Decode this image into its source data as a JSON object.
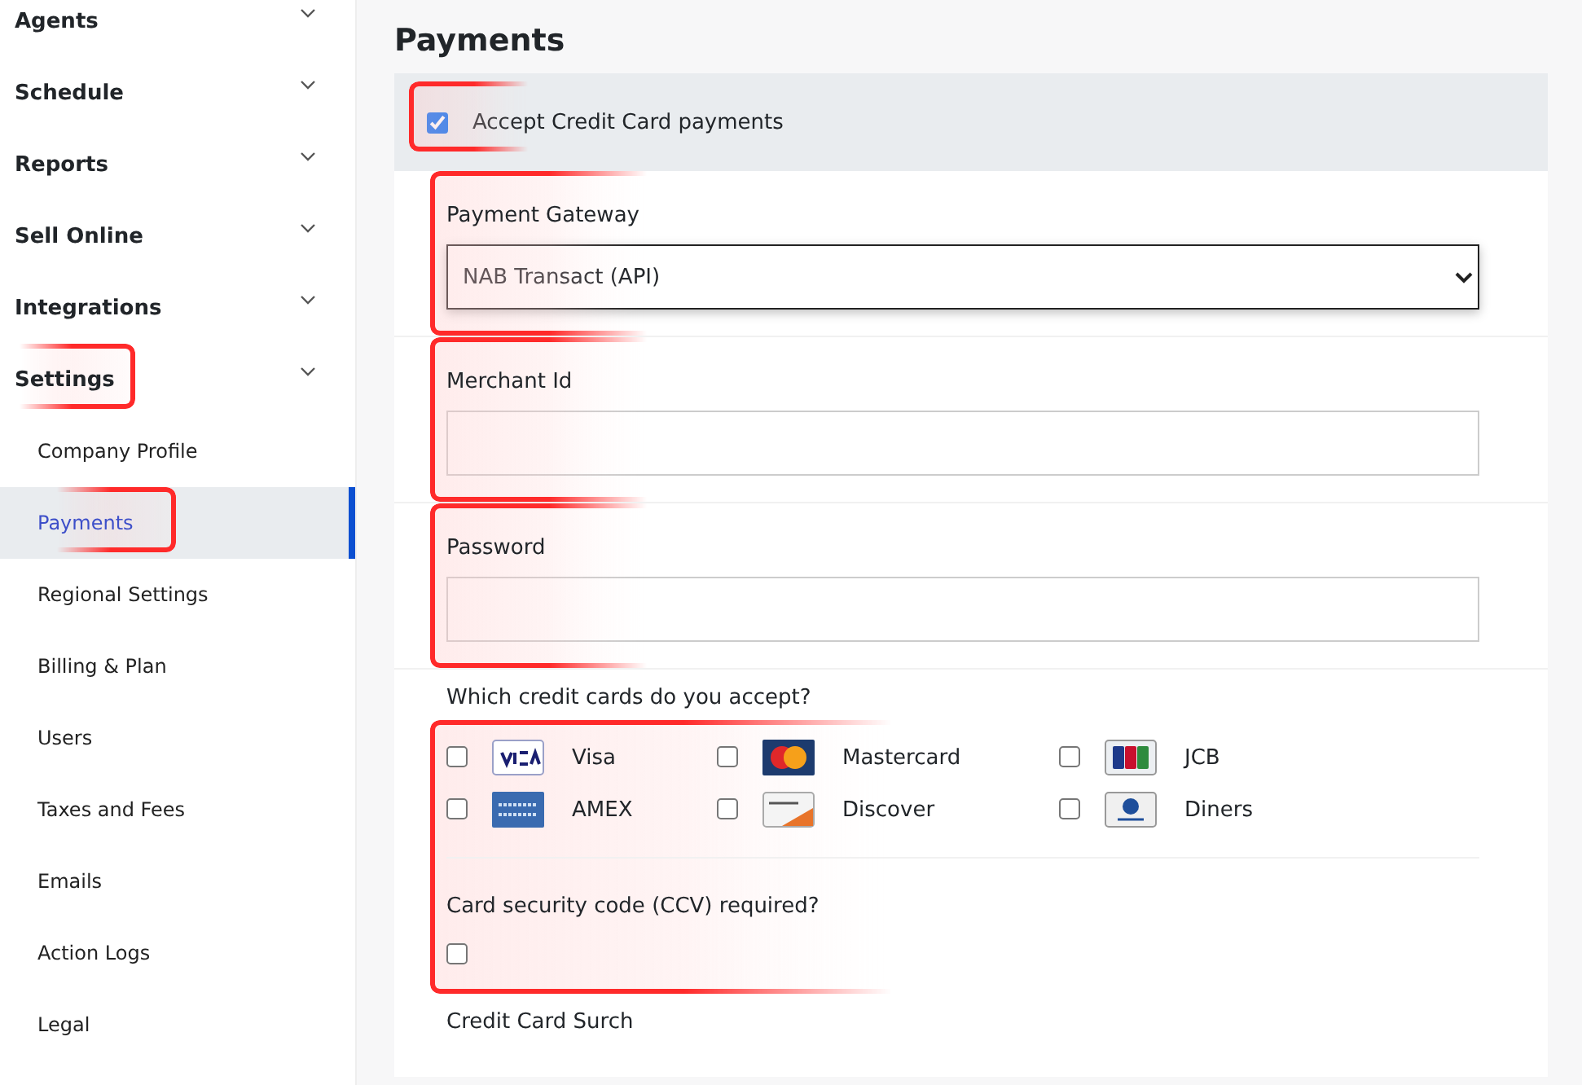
{
  "sidebar": {
    "items": [
      {
        "label": "Agents",
        "highlighted": false
      },
      {
        "label": "Schedule",
        "highlighted": false
      },
      {
        "label": "Reports",
        "highlighted": false
      },
      {
        "label": "Sell Online",
        "highlighted": false
      },
      {
        "label": "Integrations",
        "highlighted": false
      },
      {
        "label": "Settings",
        "highlighted": true,
        "children": [
          {
            "label": "Company Profile",
            "selected": false,
            "highlighted": false
          },
          {
            "label": "Payments",
            "selected": true,
            "highlighted": true
          },
          {
            "label": "Regional Settings",
            "selected": false,
            "highlighted": false
          },
          {
            "label": "Billing & Plan",
            "selected": false,
            "highlighted": false
          },
          {
            "label": "Users",
            "selected": false,
            "highlighted": false
          },
          {
            "label": "Taxes and Fees",
            "selected": false,
            "highlighted": false
          },
          {
            "label": "Emails",
            "selected": false,
            "highlighted": false
          },
          {
            "label": "Action Logs",
            "selected": false,
            "highlighted": false
          },
          {
            "label": "Legal",
            "selected": false,
            "highlighted": false
          }
        ]
      }
    ]
  },
  "page": {
    "title": "Payments",
    "accept_credit_cards": {
      "label": "Accept Credit Card payments",
      "checked": true,
      "highlighted": true
    },
    "payment_gateway": {
      "label": "Payment Gateway",
      "value": "NAB Transact (API)",
      "highlighted": true
    },
    "merchant_id": {
      "label": "Merchant Id",
      "highlighted": true
    },
    "password": {
      "label": "Password",
      "highlighted": true
    },
    "cards": {
      "label": "Which credit cards do you accept?",
      "highlighted": true,
      "items": [
        {
          "label": "Visa",
          "kind": "visa",
          "checked": false
        },
        {
          "label": "Mastercard",
          "kind": "mastercard",
          "checked": false
        },
        {
          "label": "JCB",
          "kind": "jcb",
          "checked": false
        },
        {
          "label": "AMEX",
          "kind": "amex",
          "checked": false
        },
        {
          "label": "Discover",
          "kind": "discover",
          "checked": false
        },
        {
          "label": "Diners",
          "kind": "diners",
          "checked": false
        }
      ]
    },
    "ccv_required": {
      "label": "Card security code (CCV) required?",
      "checked": false
    },
    "next_section": {
      "label": "Credit Card Surch"
    }
  }
}
